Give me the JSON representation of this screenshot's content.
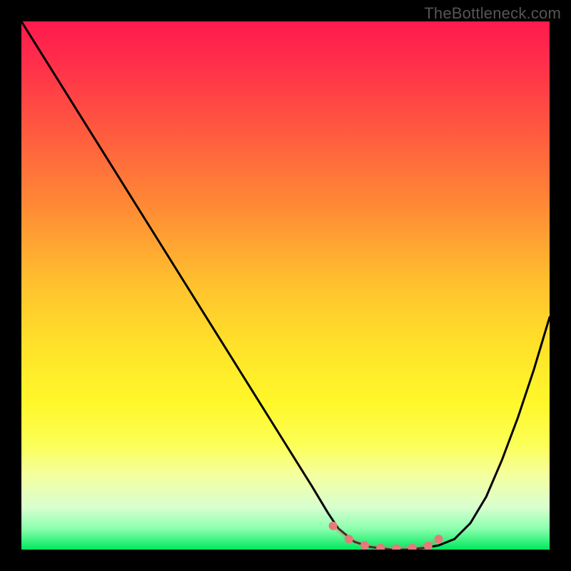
{
  "watermark": "TheBottleneck.com",
  "chart_data": {
    "type": "line",
    "title": "",
    "xlabel": "",
    "ylabel": "",
    "xlim": [
      0,
      100
    ],
    "ylim": [
      0,
      100
    ],
    "grid": false,
    "annotations": [
      "TheBottleneck.com"
    ],
    "series": [
      {
        "name": "bottleneck-curve",
        "color": "#000000",
        "x": [
          0,
          5,
          10,
          15,
          20,
          25,
          30,
          35,
          40,
          45,
          50,
          55,
          58,
          60,
          63,
          66,
          70,
          73,
          76,
          79,
          82,
          85,
          88,
          91,
          94,
          97,
          100
        ],
        "y": [
          100,
          92,
          84,
          76,
          68,
          60,
          52,
          44,
          36,
          28,
          20,
          12,
          7,
          4,
          1.5,
          0.5,
          0,
          0,
          0.3,
          0.8,
          2,
          5,
          10,
          17,
          25,
          34,
          44
        ]
      }
    ],
    "highlight_segment": {
      "name": "optimal-range-markers",
      "color": "#e67a7a",
      "x": [
        59,
        62,
        65,
        68,
        71,
        74,
        77,
        79
      ],
      "y": [
        4.5,
        2,
        0.8,
        0.3,
        0.2,
        0.3,
        0.7,
        2
      ]
    },
    "gradient_stops": [
      {
        "pos": 0,
        "color": "#ff1a4d"
      },
      {
        "pos": 50,
        "color": "#ffc22e"
      },
      {
        "pos": 80,
        "color": "#fcff55"
      },
      {
        "pos": 100,
        "color": "#00e85e"
      }
    ]
  }
}
